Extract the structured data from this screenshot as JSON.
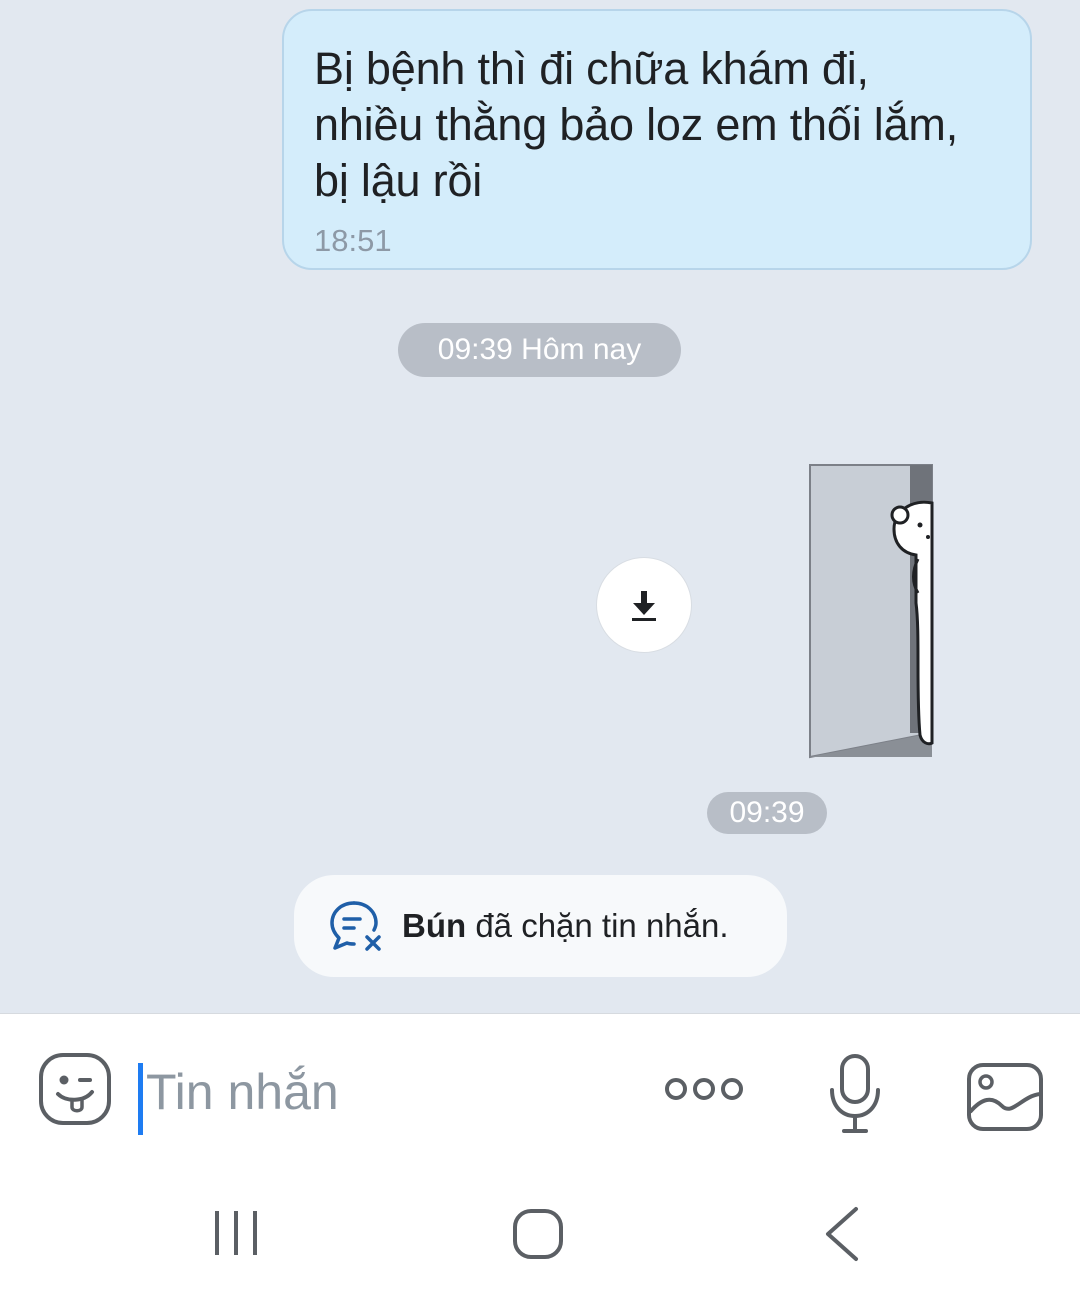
{
  "message": {
    "text": "Bị bệnh thì đi chữa khám đi,\nnhiều thằng bảo loz em thối lắm,\nbị lậu rồi",
    "time": "18:51"
  },
  "date_separator": "09:39 Hôm nay",
  "sticker_message": {
    "time": "09:39",
    "download_icon": "download-icon"
  },
  "block_notice": {
    "name": "Bún",
    "text": " đã chặn tin nhắn.",
    "icon": "chat-blocked-icon"
  },
  "composer": {
    "placeholder": "Tin nhắn",
    "value": "",
    "icons": [
      "emoji-icon",
      "more-icon",
      "microphone-icon",
      "image-icon"
    ]
  },
  "nav": {
    "icons": [
      "recents-icon",
      "home-icon",
      "back-icon"
    ]
  },
  "colors": {
    "chat_bg": "#e2e8f0",
    "bubble_bg": "#d4edfb",
    "pill_bg": "#b8bec7",
    "accent": "#1e7cf2",
    "icon_blue": "#1f5fa8"
  }
}
